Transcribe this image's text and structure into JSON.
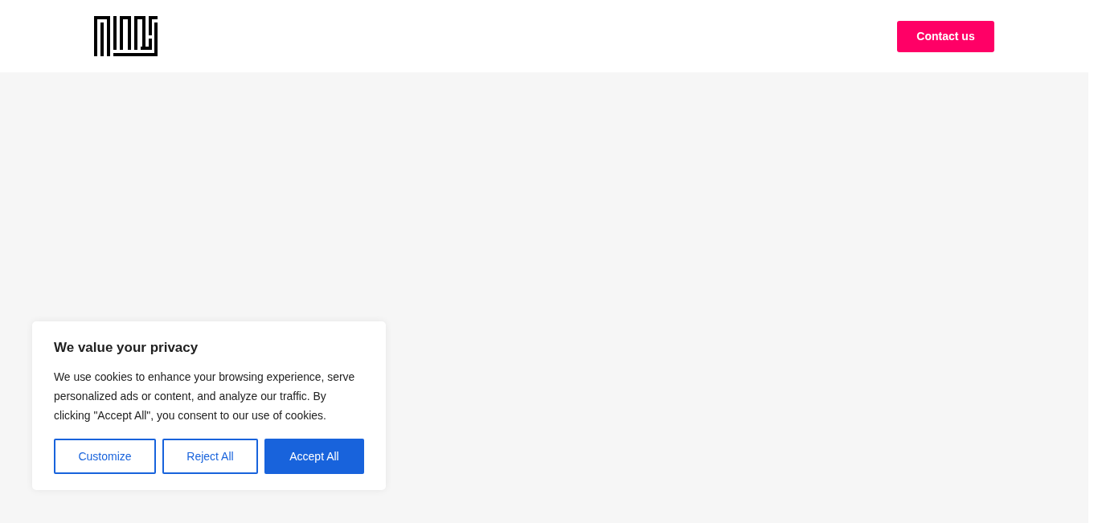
{
  "header": {
    "contact_button": "Contact us"
  },
  "cookie_banner": {
    "title": "We value your privacy",
    "text": "We use cookies to enhance your browsing experience, serve personalized ads or content, and analyze our traffic. By clicking \"Accept All\", you consent to our use of cookies.",
    "buttons": [
      {
        "label": "Customize",
        "kind": "outline"
      },
      {
        "label": "Reject All",
        "kind": "outline"
      },
      {
        "label": "Accept All",
        "kind": "filled"
      }
    ]
  }
}
